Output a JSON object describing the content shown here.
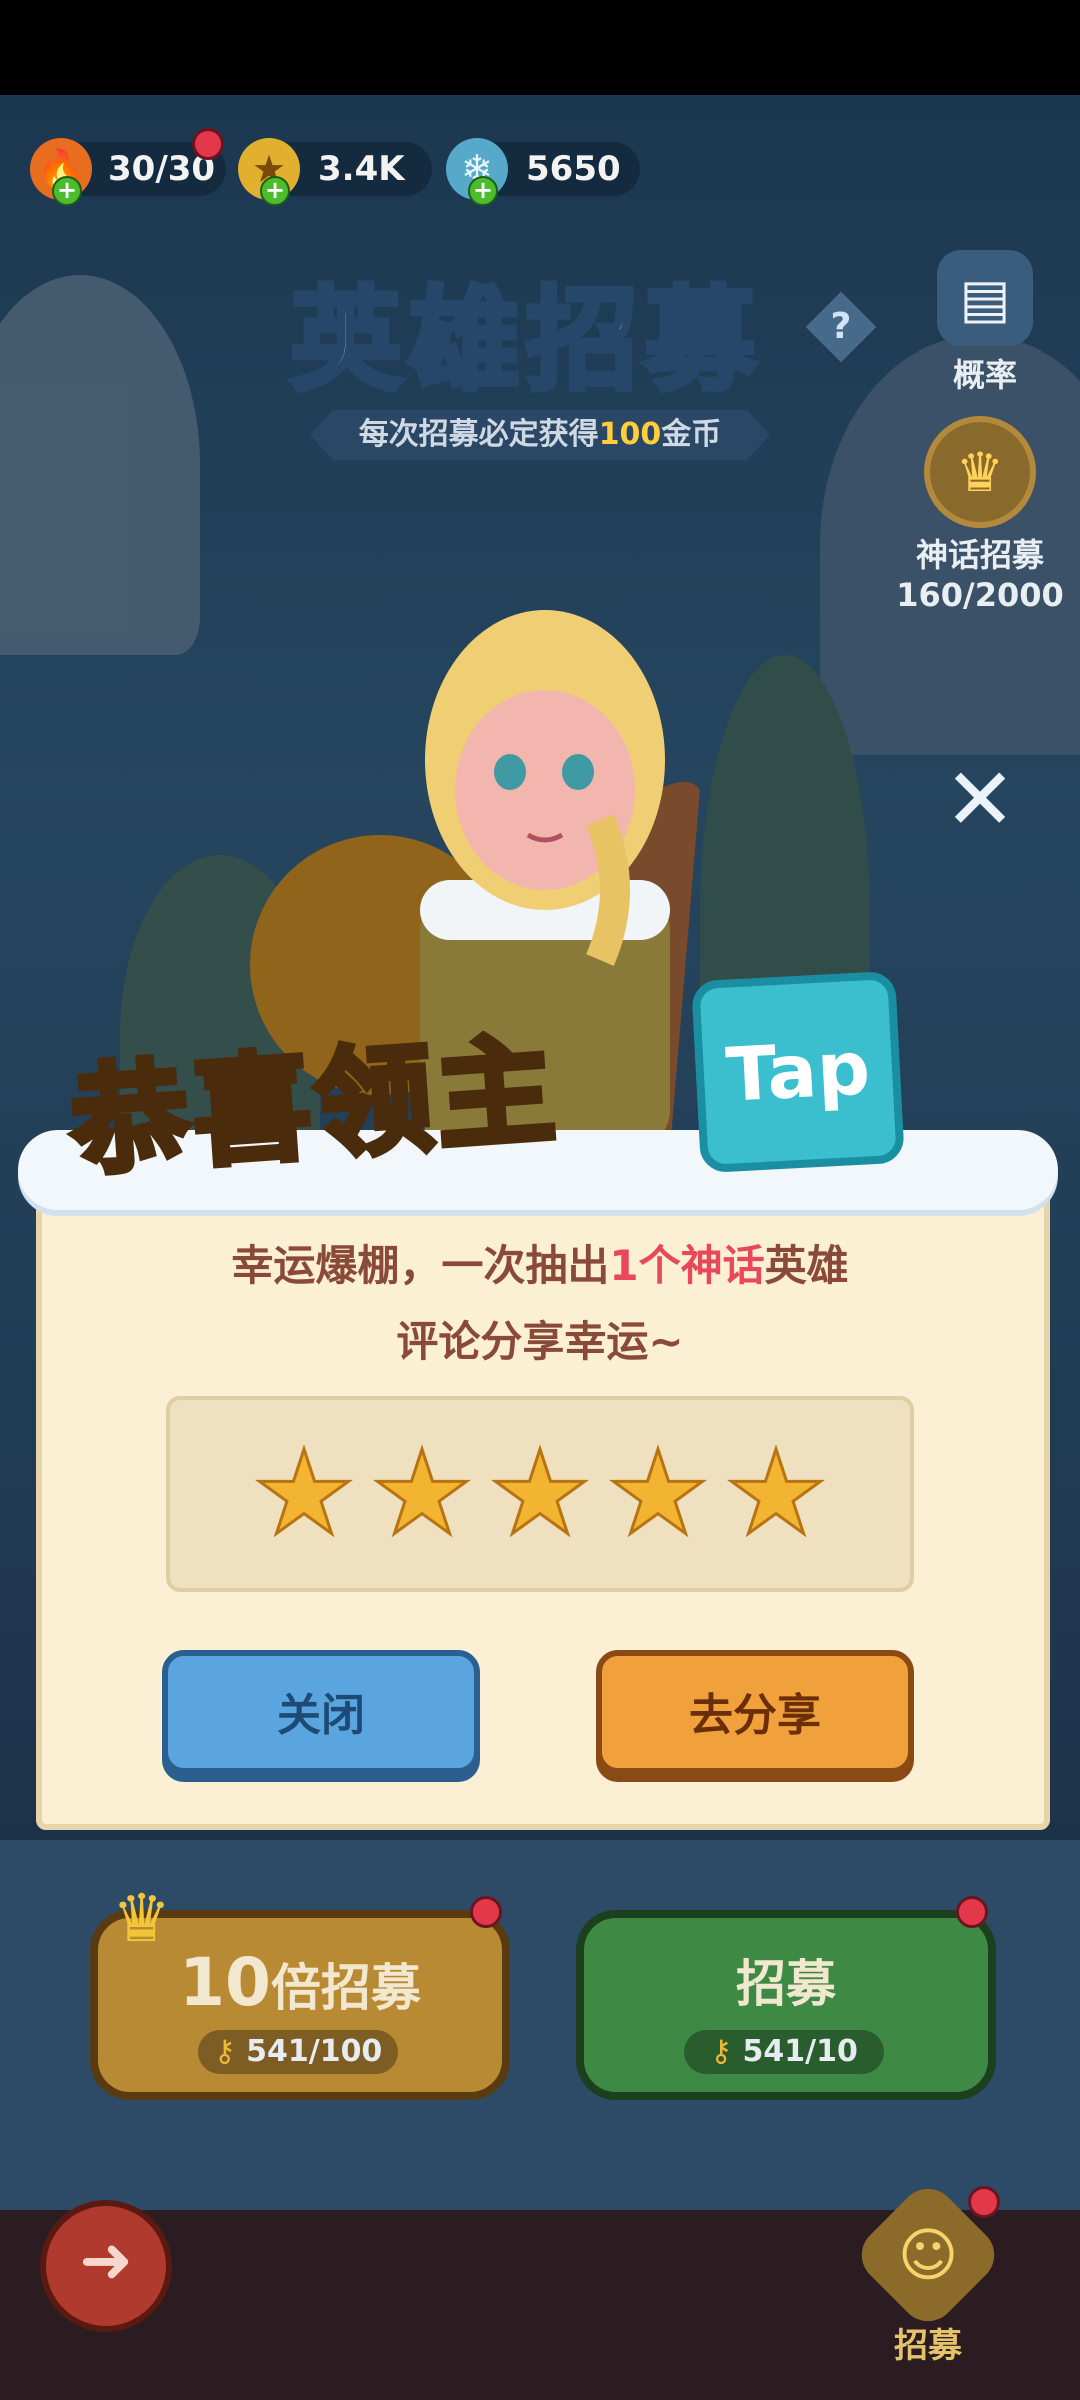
{
  "resources": {
    "stamina": {
      "icon": "flame-icon",
      "value": "30/30"
    },
    "gold": {
      "icon": "gold-coin-icon",
      "value": "3.4K"
    },
    "gems": {
      "icon": "crystal-icon",
      "value": "5650"
    }
  },
  "page": {
    "title": "英雄招募",
    "subtitle_prefix": "每次招募必定获得",
    "subtitle_amount": "100",
    "subtitle_suffix": "金币"
  },
  "side": {
    "odds_label": "概率",
    "myth_label": "神话招募",
    "myth_progress": "160/2000"
  },
  "dialog": {
    "banner": "恭喜领主",
    "tap_logo": "Tap",
    "message_prefix": "幸运爆棚，一次抽出",
    "message_highlight": "1个神话",
    "message_suffix": "英雄",
    "message_line2": "评论分享幸运~",
    "rating": 5,
    "rating_max": 5,
    "close_button": "关闭",
    "share_button": "去分享"
  },
  "recruit": {
    "ten_label_num": "10",
    "ten_label_text": "倍招募",
    "ten_cost": "541/100",
    "single_label": "招募",
    "single_cost": "541/10"
  },
  "nav": {
    "recruit_label": "招募"
  },
  "colors": {
    "accent_gold": "#ffce3a",
    "highlight_pink": "#e8485a",
    "close_blue": "#5aa5e0",
    "share_orange": "#f0a13b"
  }
}
